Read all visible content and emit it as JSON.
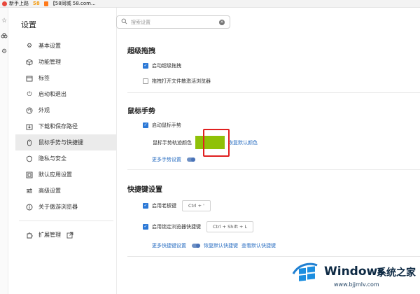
{
  "bookmarks": [
    {
      "label": "新手上路",
      "icon": "red-circle-favicon"
    },
    {
      "label": "58",
      "icon": "58-favicon"
    },
    {
      "label": "【58同城 58.com...",
      "icon": "orange-favicon"
    }
  ],
  "settings_title": "设置",
  "search": {
    "placeholder": "搜索设置"
  },
  "sidebar": {
    "items": [
      {
        "label": "基本设置",
        "icon": "gear-icon"
      },
      {
        "label": "功能管理",
        "icon": "cube-icon"
      },
      {
        "label": "标签",
        "icon": "tab-icon"
      },
      {
        "label": "启动和退出",
        "icon": "power-icon"
      },
      {
        "label": "外观",
        "icon": "palette-icon"
      },
      {
        "label": "下载和保存路径",
        "icon": "download-icon"
      },
      {
        "label": "鼠标手势与快捷键",
        "icon": "mouse-icon",
        "active": true
      },
      {
        "label": "隐私与安全",
        "icon": "shield-icon"
      },
      {
        "label": "默认应用设置",
        "icon": "default-app-icon"
      },
      {
        "label": "高级设置",
        "icon": "sliders-icon"
      },
      {
        "label": "关于傲游浏览器",
        "icon": "info-icon"
      }
    ],
    "extensions": {
      "label": "扩展管理",
      "icon": "puzzle-icon",
      "link_icon": "external-link-icon"
    }
  },
  "super_drag": {
    "title": "超级拖拽",
    "enable_label": "启动超级拖拽",
    "enable_checked": true,
    "background_open_label": "拖拽打开文件散激活浏览器",
    "background_open_checked": false
  },
  "mouse_gesture": {
    "title": "鼠标手势",
    "enable_label": "启动鼠标手势",
    "enable_checked": true,
    "trail_color_label": "鼠标手势轨迹颜色",
    "trail_color": "#8fc108",
    "restore_default_color": "恢复默认颜色",
    "more_settings": "更多手势设置"
  },
  "shortcuts": {
    "title": "快捷键设置",
    "boss_key_label": "启用老板键",
    "boss_key_checked": true,
    "boss_key_value": "Ctrl + '",
    "lock_shortcut_label": "启用锁定浏览器快捷键",
    "lock_shortcut_checked": true,
    "lock_shortcut_value": "Ctrl + Shift + L",
    "more_settings": "更多快捷键设置",
    "restore_default": "恢复默认快捷键",
    "view_default": "查看默认快捷键"
  },
  "watermark": {
    "brand": "Windows",
    "site_cn": "系统之家",
    "url": "www.bjjmlv.com"
  },
  "colors": {
    "accent": "#2b78d6",
    "link": "#2b6fc2",
    "highlight_border": "#e02020",
    "active_nav": "#ebebeb"
  }
}
